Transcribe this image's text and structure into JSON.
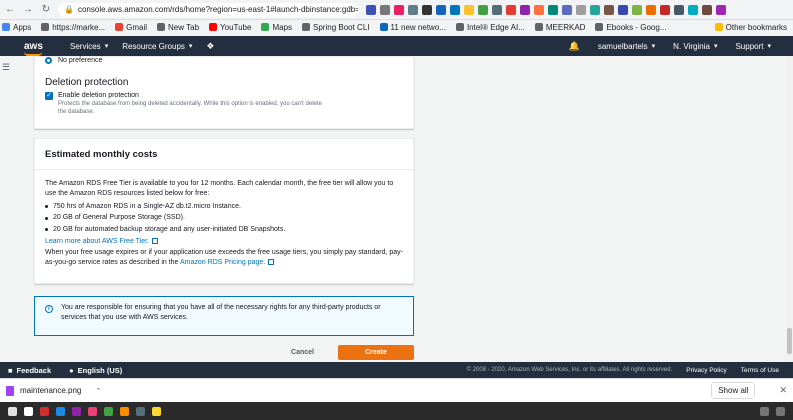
{
  "browser": {
    "url": "console.aws.amazon.com/rds/home?region=us-east-1#launch-dbinstance:gdb=false;...",
    "bookmarks": [
      {
        "label": "Apps",
        "color": "#4285f4"
      },
      {
        "label": "https://marke...",
        "color": "#5f6368"
      },
      {
        "label": "Gmail",
        "color": "#ea4335"
      },
      {
        "label": "New Tab",
        "color": "#5f6368"
      },
      {
        "label": "YouTube",
        "color": "#ff0000"
      },
      {
        "label": "Maps",
        "color": "#34a853"
      },
      {
        "label": "Spring Boot CLI",
        "color": "#5f6368"
      },
      {
        "label": "11 new netwo...",
        "color": "#0a66c2"
      },
      {
        "label": "Intel® Edge AI...",
        "color": "#5f6368"
      },
      {
        "label": "MEERKAD",
        "color": "#5f6368"
      },
      {
        "label": "Ebooks - Goog...",
        "color": "#5f6368"
      }
    ],
    "other_bookmarks": "Other bookmarks"
  },
  "aws_nav": {
    "logo": "aws",
    "services": "Services",
    "resource_groups": "Resource Groups",
    "user": "samuelbartels",
    "region": "N. Virginia",
    "support": "Support"
  },
  "top_panel": {
    "radio_label": "No preference",
    "section_title": "Deletion protection",
    "checkbox_label": "Enable deletion protection",
    "checkbox_desc": "Protects the database from being deleted accidentally. While this option is enabled, you can't delete the database."
  },
  "costs": {
    "title": "Estimated monthly costs",
    "intro": "The Amazon RDS Free Tier is available to you for 12 months. Each calendar month, the free tier will allow you to use the Amazon RDS resources listed below for free:",
    "items": [
      "750 hrs of Amazon RDS in a Single-AZ db.t2.micro Instance.",
      "20 GB of General Purpose Storage (SSD).",
      "20 GB for automated backup storage and any user-initiated DB Snapshots."
    ],
    "learn_more": "Learn more about AWS Free Tier.",
    "outro": "When your free usage expires or if your application use exceeds the free usage tiers, you simply pay standard, pay-as-you-go service rates as described in the ",
    "pricing_link": "Amazon RDS Pricing page."
  },
  "info": {
    "text": "You are responsible for ensuring that you have all of the necessary rights for any third-party products or services that you use with AWS services."
  },
  "actions": {
    "cancel": "Cancel",
    "create": "Create database"
  },
  "footer": {
    "feedback": "Feedback",
    "language": "English (US)",
    "copyright": "© 2008 - 2020, Amazon Web Services, Inc. or its affiliates. All rights reserved.",
    "privacy": "Privacy Policy",
    "terms": "Terms of Use"
  },
  "downloads": {
    "file": "maintenance.png",
    "show_all": "Show all"
  },
  "colors": {
    "aws_nav_bg": "#232f3e",
    "create_button": "#ec7211",
    "link": "#0073bb"
  }
}
